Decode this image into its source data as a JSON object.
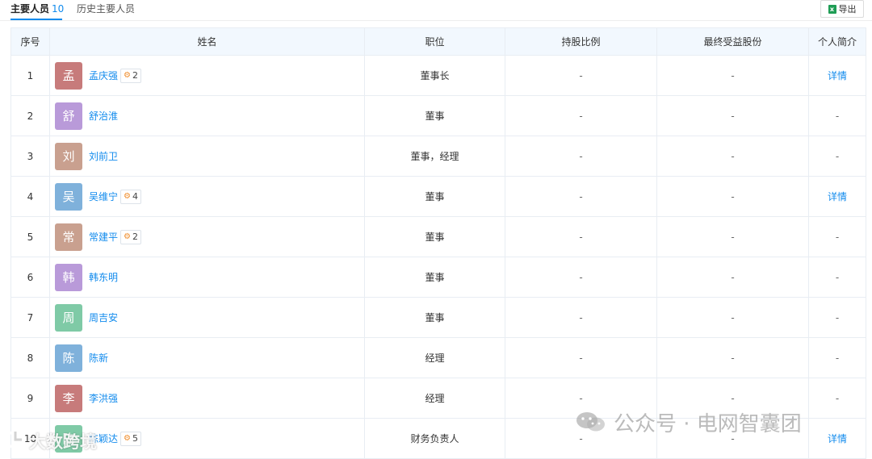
{
  "tabs": {
    "main_label": "主要人员",
    "main_count": "10",
    "history_label": "历史主要人员"
  },
  "toolbar": {
    "export_label": "导出",
    "export_icon": "excel-icon"
  },
  "table": {
    "headers": [
      "序号",
      "姓名",
      "职位",
      "持股比例",
      "最终受益股份",
      "个人简介"
    ],
    "rows": [
      {
        "seq": "1",
        "avatar": "孟",
        "avatar_color": "#c77b7b",
        "name": "孟庆强",
        "badge": "2",
        "position": "董事长",
        "share": "-",
        "benefit": "-",
        "profile": "详情"
      },
      {
        "seq": "2",
        "avatar": "舒",
        "avatar_color": "#b99ad9",
        "name": "舒治淮",
        "badge": "",
        "position": "董事",
        "share": "-",
        "benefit": "-",
        "profile": "-"
      },
      {
        "seq": "3",
        "avatar": "刘",
        "avatar_color": "#c9a08f",
        "name": "刘前卫",
        "badge": "",
        "position": "董事，经理",
        "share": "-",
        "benefit": "-",
        "profile": "-"
      },
      {
        "seq": "4",
        "avatar": "吴",
        "avatar_color": "#7fb1db",
        "name": "吴维宁",
        "badge": "4",
        "position": "董事",
        "share": "-",
        "benefit": "-",
        "profile": "详情"
      },
      {
        "seq": "5",
        "avatar": "常",
        "avatar_color": "#c9a08f",
        "name": "常建平",
        "badge": "2",
        "position": "董事",
        "share": "-",
        "benefit": "-",
        "profile": "-"
      },
      {
        "seq": "6",
        "avatar": "韩",
        "avatar_color": "#b99ad9",
        "name": "韩东明",
        "badge": "",
        "position": "董事",
        "share": "-",
        "benefit": "-",
        "profile": "-"
      },
      {
        "seq": "7",
        "avatar": "周",
        "avatar_color": "#7fcaa6",
        "name": "周吉安",
        "badge": "",
        "position": "董事",
        "share": "-",
        "benefit": "-",
        "profile": "-"
      },
      {
        "seq": "8",
        "avatar": "陈",
        "avatar_color": "#7fb1db",
        "name": "陈新",
        "badge": "",
        "position": "经理",
        "share": "-",
        "benefit": "-",
        "profile": "-"
      },
      {
        "seq": "9",
        "avatar": "李",
        "avatar_color": "#c77b7b",
        "name": "李洪强",
        "badge": "",
        "position": "经理",
        "share": "-",
        "benefit": "-",
        "profile": "-"
      },
      {
        "seq": "10",
        "avatar": "陈",
        "avatar_color": "#7fcaa6",
        "name": "陈颖达",
        "badge": "5",
        "position": "财务负责人",
        "share": "-",
        "benefit": "-",
        "profile": "详情"
      }
    ]
  },
  "watermarks": {
    "right_text": "公众号 · 电网智囊团",
    "right_icon": "wechat-icon",
    "left_text": "大数跨境",
    "left_icon": "logo-icon"
  }
}
